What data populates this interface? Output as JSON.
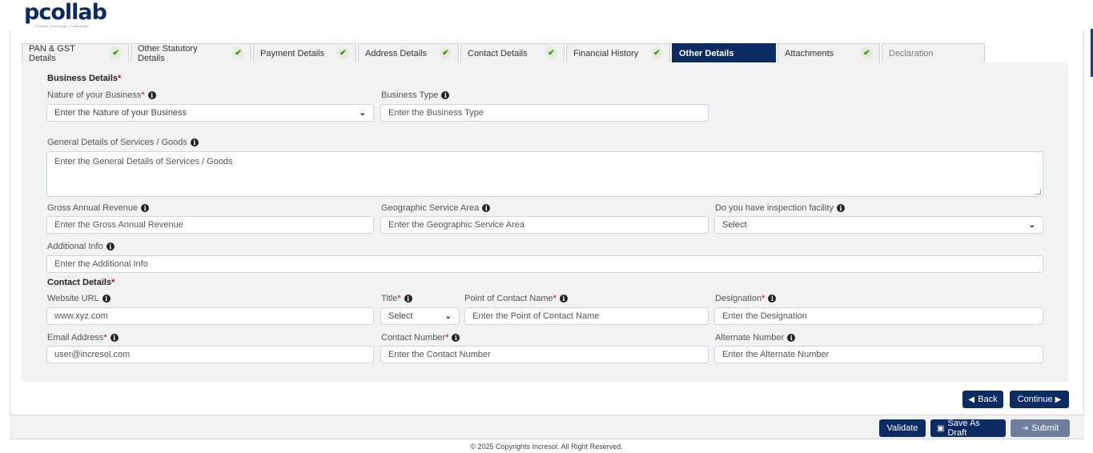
{
  "brand": {
    "logo_text": "collab",
    "logo_letter": "p",
    "tagline": "Connect | Exchange | Collaborate"
  },
  "tabs": [
    {
      "label": "PAN & GST Details",
      "done": true
    },
    {
      "label": "Other Statutory Details",
      "done": true
    },
    {
      "label": "Payment Details",
      "done": true
    },
    {
      "label": "Address Details",
      "done": true
    },
    {
      "label": "Contact Details",
      "done": true
    },
    {
      "label": "Financial History",
      "done": true
    },
    {
      "label": "Other Details",
      "active": true
    },
    {
      "label": "Attachments",
      "done": true
    },
    {
      "label": "Declaration"
    }
  ],
  "business": {
    "title": "Business Details",
    "nature_label": "Nature of your Business",
    "nature_placeholder": "Enter the Nature of your Business",
    "type_label": "Business Type",
    "type_placeholder": "Enter the Business Type",
    "general_label": "General Details of Services / Goods",
    "general_placeholder": "Enter the General Details of Services / Goods",
    "revenue_label": "Gross Annual Revenue",
    "revenue_placeholder": "Enter the Gross Annual Revenue",
    "geo_label": "Geographic Service Area",
    "geo_placeholder": "Enter the Geographic Service Area",
    "inspection_label": "Do you have inspection facility",
    "inspection_value": "Select",
    "additional_label": "Additional Info",
    "additional_placeholder": "Enter the Additional Info"
  },
  "contact": {
    "title": "Contact Details",
    "website_label": "Website URL",
    "website_value": "www.xyz.com",
    "title_label": "Title",
    "title_value": "Select",
    "poc_label": "Point of Contact Name",
    "poc_placeholder": "Enter the Point of Contact Name",
    "designation_label": "Designation",
    "designation_placeholder": "Enter the Designation",
    "email_label": "Email Address",
    "email_value": "user@incresol.com",
    "contact_label": "Contact Number",
    "contact_placeholder": "Enter the Contact Number",
    "alternate_label": "Alternate Number",
    "alternate_placeholder": "Enter the Alternate Number"
  },
  "actions": {
    "back": "Back",
    "continue": "Continue",
    "validate": "Validate",
    "save_draft": "Save As Draft",
    "submit": "Submit"
  },
  "footer": {
    "copyright": "© 2025 Copyrights Incresol. All Right Reserved."
  },
  "colors": {
    "primary": "#0d2b63",
    "required": "#d0021b",
    "check": "#3a8a1a"
  }
}
